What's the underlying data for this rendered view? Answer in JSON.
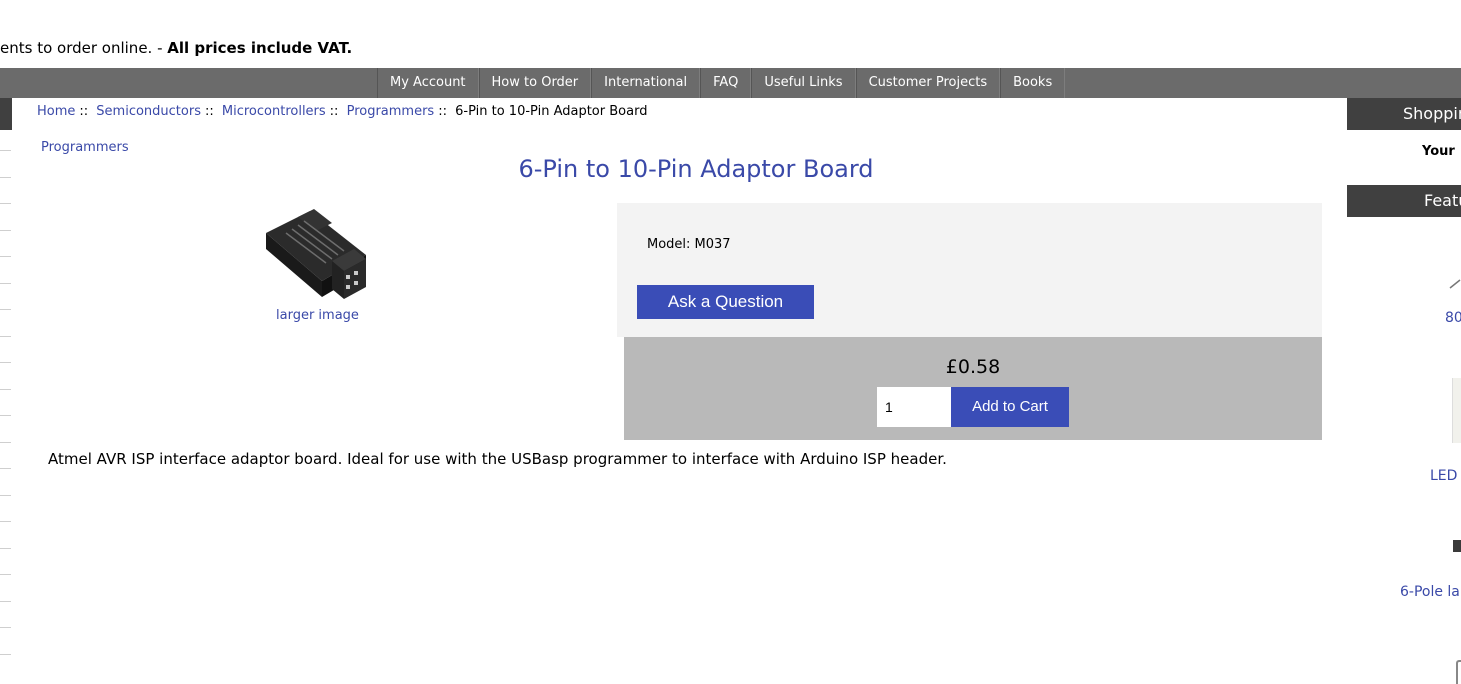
{
  "header": {
    "notice_prefix": "ents to order online. - ",
    "notice_bold": "All prices include VAT."
  },
  "nav": {
    "items": [
      "My Account",
      "How to Order",
      "International",
      "FAQ",
      "Useful Links",
      "Customer Projects",
      "Books"
    ]
  },
  "breadcrumb": {
    "home": "Home",
    "cat1": "Semiconductors",
    "cat2": "Microcontrollers",
    "cat3": "Programmers",
    "current": "6-Pin to 10-Pin Adaptor Board",
    "sep": "::"
  },
  "product": {
    "category_link": "Programmers",
    "title": "6-Pin to 10-Pin Adaptor Board",
    "larger_image": "larger image",
    "model": "Model: M037",
    "ask_button": "Ask a Question",
    "price": "£0.58",
    "qty_value": "1",
    "add_button": "Add to Cart",
    "description": "Atmel AVR ISP interface adaptor board. Ideal for use with the USBasp programmer to interface with Arduino ISP header."
  },
  "sidebar": {
    "shopping_heading": "Shoppin",
    "your_text": "Your",
    "featured_heading": "Featu",
    "item1": "80",
    "item2": "LED",
    "item3": "6-Pole la"
  },
  "colors": {
    "link": "#3a49a8",
    "button": "#3a4db7",
    "nav_bg": "#6b6b6b",
    "sidebar_head": "#404040"
  }
}
